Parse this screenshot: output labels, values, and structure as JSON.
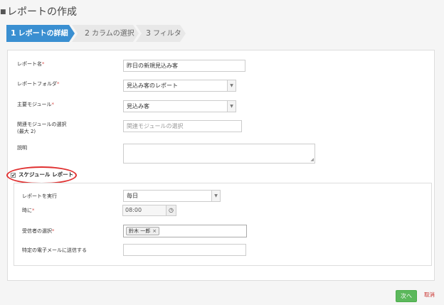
{
  "page": {
    "title": "レポートの作成",
    "title_icon": "report-icon"
  },
  "wizard": {
    "steps": [
      {
        "num": "1",
        "label": "レポートの詳細",
        "active": true
      },
      {
        "num": "2",
        "label": "カラムの選択",
        "active": false
      },
      {
        "num": "3",
        "label": "フィルタ",
        "active": false
      }
    ]
  },
  "form": {
    "report_name": {
      "label": "レポート名",
      "required": "*",
      "value": "昨日の新規見込み客"
    },
    "report_folder": {
      "label": "レポートフォルダ",
      "required": "*",
      "value": "見込み客のレポート"
    },
    "primary_module": {
      "label": "主要モジュール",
      "required": "*",
      "value": "見込み客"
    },
    "related_modules": {
      "label_line1": "関連モジュールの選択",
      "label_line2": "(最大 2)",
      "placeholder": "関連モジュールの選択"
    },
    "description": {
      "label": "説明",
      "value": ""
    }
  },
  "schedule": {
    "checkbox_label": "スケジュール レポート",
    "checked": true,
    "run": {
      "label": "レポートを実行",
      "value": "毎日"
    },
    "at": {
      "label": "時に",
      "required": "*",
      "value": "08:00"
    },
    "recipients": {
      "label": "受信者の選択",
      "required": "*",
      "tags": [
        "鈴木 一郎"
      ]
    },
    "specific_email": {
      "label": "特定の電子メールに送信する",
      "value": ""
    }
  },
  "actions": {
    "next_label": "次へ",
    "cancel_label": "取消"
  },
  "colors": {
    "accent": "#3a8fd1",
    "success": "#5cb85c",
    "annotation": "#e03030",
    "required": "#d9534f"
  }
}
